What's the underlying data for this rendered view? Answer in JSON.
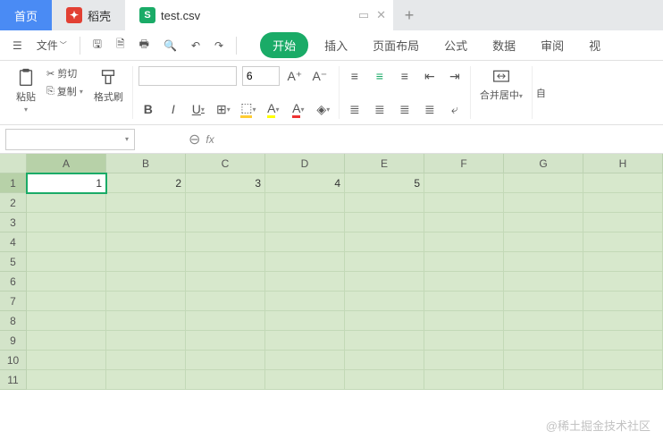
{
  "tabs": {
    "home": "首页",
    "docer": "稻壳",
    "file": "test.csv",
    "add": "+"
  },
  "menu": {
    "file": "文件"
  },
  "ribbon_tabs": [
    "开始",
    "插入",
    "页面布局",
    "公式",
    "数据",
    "审阅",
    "视"
  ],
  "clip": {
    "paste": "粘贴",
    "cut": "剪切",
    "copy": "复制",
    "brush": "格式刷"
  },
  "font": {
    "name": "",
    "size": "6",
    "bold": "B",
    "italic": "I"
  },
  "merge": {
    "label": "合并居中",
    "auto": "自"
  },
  "namebox": {
    "value": ""
  },
  "fx": {
    "label": "fx"
  },
  "columns": [
    "A",
    "B",
    "C",
    "D",
    "E",
    "F",
    "G",
    "H"
  ],
  "rows": [
    "1",
    "2",
    "3",
    "4",
    "5",
    "6",
    "7",
    "8",
    "9",
    "10",
    "11"
  ],
  "cells": {
    "r0": [
      "1",
      "2",
      "3",
      "4",
      "5",
      "",
      "",
      ""
    ],
    "empty": [
      "",
      "",
      "",
      "",
      "",
      "",
      "",
      ""
    ]
  },
  "active": {
    "row": 0,
    "col": 0
  },
  "watermark": "@稀土掘金技术社区",
  "chart_data": {
    "type": "table",
    "columns": [
      "A",
      "B",
      "C",
      "D",
      "E",
      "F",
      "G",
      "H"
    ],
    "rows": [
      [
        1,
        2,
        3,
        4,
        5,
        null,
        null,
        null
      ]
    ]
  }
}
